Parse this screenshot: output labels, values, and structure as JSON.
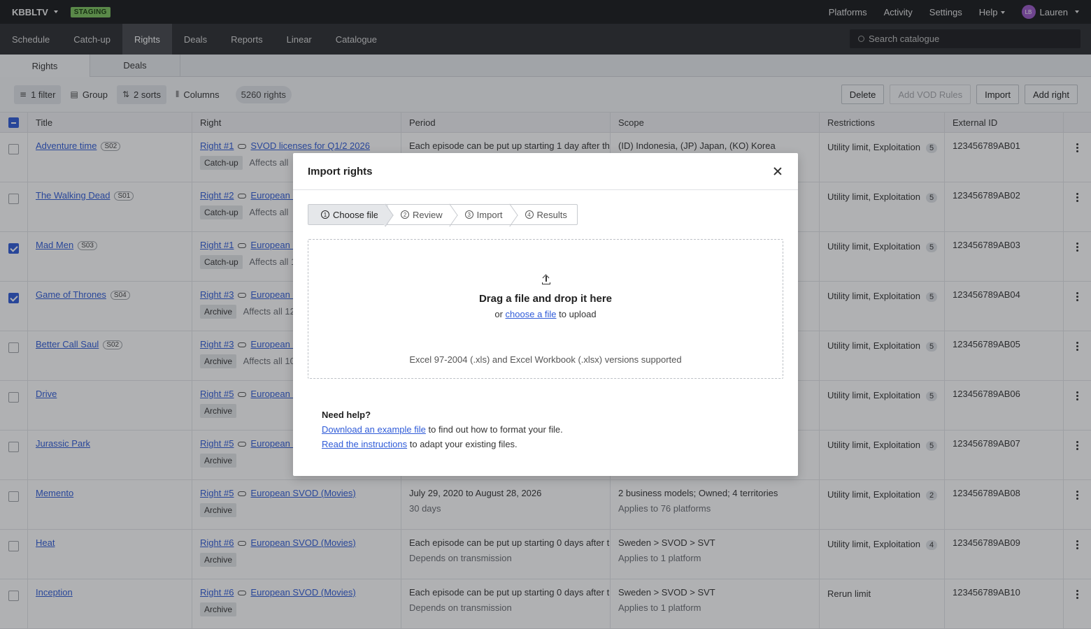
{
  "app": {
    "name": "KBBLTV",
    "env_badge": "STAGING"
  },
  "topnav": {
    "items": [
      "Platforms",
      "Activity",
      "Settings",
      "Help"
    ],
    "user_initials": "LB",
    "user_name": "Lauren"
  },
  "mainnav": {
    "tabs": [
      "Schedule",
      "Catch-up",
      "Rights",
      "Deals",
      "Reports",
      "Linear",
      "Catalogue"
    ],
    "active": "Rights",
    "search_placeholder": "Search catalogue"
  },
  "subtabs": {
    "tabs": [
      "Rights",
      "Deals"
    ],
    "active": "Rights"
  },
  "toolbar": {
    "filter": "1 filter",
    "group": "Group",
    "sorts": "2 sorts",
    "columns": "Columns",
    "count": "5260 rights",
    "delete": "Delete",
    "add_vod_rules": "Add VOD Rules",
    "import": "Import",
    "add_right": "Add right"
  },
  "table": {
    "headers": [
      "Title",
      "Right",
      "Period",
      "Scope",
      "Restrictions",
      "External ID"
    ],
    "rows": [
      {
        "checked": false,
        "title": "Adventure time",
        "season": "S02",
        "right": "Right #1",
        "deal": "SVOD licenses for Q1/2 2026",
        "tag": "Catch-up",
        "affects": "Affects all",
        "period1": "Each episode can be put up starting 1 day after the",
        "period2": "",
        "scope1": "(ID) Indonesia, (JP) Japan, (KO) Korea",
        "scope2": "",
        "restrictions": "Utility limit, Exploitation",
        "rcount": "5",
        "ext": "123456789AB01"
      },
      {
        "checked": false,
        "title": "The Walking Dead",
        "season": "S01",
        "right": "Right #2",
        "deal": "European S",
        "tag": "Catch-up",
        "affects": "Affects all",
        "period1": "",
        "period2": "",
        "scope1": "",
        "scope2": "",
        "restrictions": "Utility limit, Exploitation",
        "rcount": "5",
        "ext": "123456789AB02"
      },
      {
        "checked": true,
        "title": "Mad Men",
        "season": "S03",
        "right": "Right #1",
        "deal": "European S",
        "tag": "Catch-up",
        "affects": "Affects all 1",
        "period1": "",
        "period2": "",
        "scope1": "",
        "scope2": "",
        "restrictions": "Utility limit, Exploitation",
        "rcount": "5",
        "ext": "123456789AB03"
      },
      {
        "checked": true,
        "title": "Game of Thrones",
        "season": "S04",
        "right": "Right #3",
        "deal": "European S",
        "tag": "Archive",
        "affects": "Affects all 12",
        "period1": "",
        "period2": "",
        "scope1": "",
        "scope2": "",
        "restrictions": "Utility limit, Exploitation",
        "rcount": "5",
        "ext": "123456789AB04"
      },
      {
        "checked": false,
        "title": "Better Call Saul",
        "season": "S02",
        "right": "Right #3",
        "deal": "European S",
        "tag": "Archive",
        "affects": "Affects all 10",
        "period1": "",
        "period2": "",
        "scope1": "",
        "scope2": "",
        "restrictions": "Utility limit, Exploitation",
        "rcount": "5",
        "ext": "123456789AB05"
      },
      {
        "checked": false,
        "title": "Drive",
        "season": "",
        "right": "Right #5",
        "deal": "European S",
        "tag": "Archive",
        "affects": "",
        "period1": "",
        "period2": "",
        "scope1": "",
        "scope2": "",
        "restrictions": "Utility limit, Exploitation",
        "rcount": "5",
        "ext": "123456789AB06"
      },
      {
        "checked": false,
        "title": "Jurassic Park",
        "season": "",
        "right": "Right #5",
        "deal": "European S",
        "tag": "Archive",
        "affects": "",
        "period1": "",
        "period2": "",
        "scope1": "",
        "scope2": "",
        "restrictions": "Utility limit, Exploitation",
        "rcount": "5",
        "ext": "123456789AB07"
      },
      {
        "checked": false,
        "title": "Memento",
        "season": "",
        "right": "Right #5",
        "deal": "European SVOD (Movies)",
        "tag": "Archive",
        "affects": "",
        "period1": "July 29, 2020 to August 28, 2026",
        "period2": "30 days",
        "scope1": "2 business models; Owned; 4 territories",
        "scope2": "Applies to 76 platforms",
        "restrictions": "Utility limit, Exploitation",
        "rcount": "2",
        "ext": "123456789AB08"
      },
      {
        "checked": false,
        "title": "Heat",
        "season": "",
        "right": "Right #6",
        "deal": "European SVOD (Movies)",
        "tag": "Archive",
        "affects": "",
        "period1": "Each episode can be put up starting 0 days after th",
        "period2": "Depends on transmission",
        "scope1": "Sweden > SVOD > SVT",
        "scope2": "Applies to 1 platform",
        "restrictions": "Utility limit, Exploitation",
        "rcount": "4",
        "ext": "123456789AB09"
      },
      {
        "checked": false,
        "title": "Inception",
        "season": "",
        "right": "Right #6",
        "deal": "European SVOD (Movies)",
        "tag": "Archive",
        "affects": "",
        "period1": "Each episode can be put up starting 0 days after th",
        "period2": "Depends on transmission",
        "scope1": "Sweden > SVOD > SVT",
        "scope2": "Applies to 1 platform",
        "restrictions": "Rerun limit",
        "rcount": "",
        "ext": "123456789AB10"
      }
    ]
  },
  "modal": {
    "title": "Import rights",
    "steps": [
      {
        "n": "1",
        "label": "Choose file"
      },
      {
        "n": "2",
        "label": "Review"
      },
      {
        "n": "3",
        "label": "Import"
      },
      {
        "n": "4",
        "label": "Results"
      }
    ],
    "dropzone": {
      "title": "Drag a file and drop it here",
      "sub_prefix": "or ",
      "sub_link": "choose a file",
      "sub_suffix": " to upload",
      "note": "Excel 97-2004 (.xls) and Excel Workbook (.xlsx) versions supported"
    },
    "help": {
      "title": "Need help?",
      "link1": "Download an example file",
      "text1": " to find out how to format your file.",
      "link2": "Read the instructions",
      "text2": " to adapt your existing files."
    }
  }
}
